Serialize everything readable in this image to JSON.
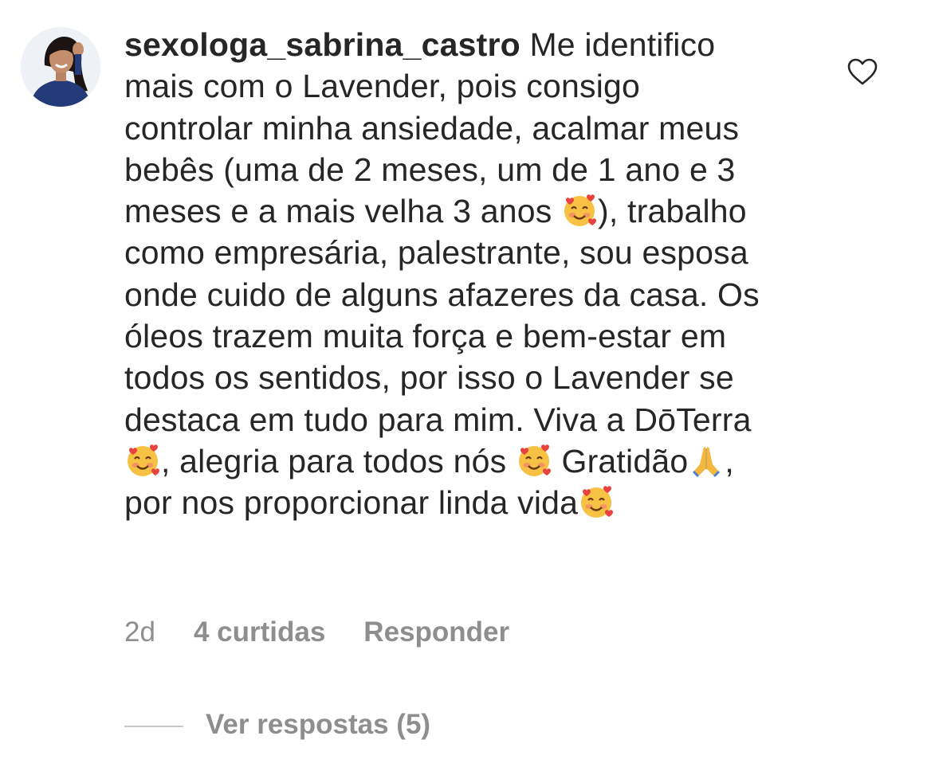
{
  "comment": {
    "username": "sexologa_sabrina_castro",
    "segments": [
      {
        "type": "text",
        "value": "Me identifico mais com o Lavender, pois consigo controlar minha ansiedade, acalmar meus bebês (uma de 2 meses, um de 1 ano e 3 meses e a mais velha 3 anos "
      },
      {
        "type": "emoji",
        "name": "smiling-face-with-hearts-emoji"
      },
      {
        "type": "text",
        "value": "), trabalho como empresária, palestrante, sou esposa onde cuido de alguns afazeres da casa. Os óleos trazem muita força e bem-estar em todos os sentidos, por isso o Lavender se destaca em tudo para mim. Viva a DōTerra"
      },
      {
        "type": "emoji",
        "name": "smiling-face-with-hearts-emoji"
      },
      {
        "type": "text",
        "value": ", alegria para todos nós "
      },
      {
        "type": "emoji",
        "name": "smiling-face-with-hearts-emoji"
      },
      {
        "type": "text",
        "value": " Gratidão"
      },
      {
        "type": "emoji",
        "name": "folded-hands-emoji"
      },
      {
        "type": "text",
        "value": ", por nos proporcionar linda vida"
      },
      {
        "type": "emoji",
        "name": "smiling-face-with-hearts-emoji"
      }
    ],
    "time": "2d",
    "likes": "4 curtidas",
    "reply_label": "Responder",
    "view_replies": "Ver respostas (5)",
    "like_icon": "heart-outline-icon"
  },
  "colors": {
    "text": "#262626",
    "secondary": "#8e8e8e",
    "divider": "#c7c7c7",
    "background": "#ffffff"
  }
}
